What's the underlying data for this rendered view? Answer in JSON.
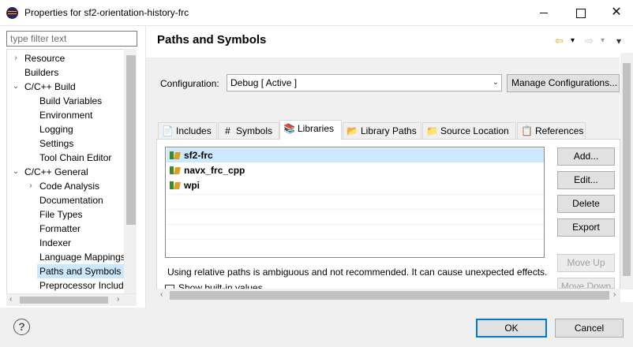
{
  "window": {
    "title": "Properties for sf2-orientation-history-frc",
    "minimize_icon": "minimize-icon",
    "maximize_icon": "maximize-icon",
    "close_glyph": "✕"
  },
  "filter": {
    "placeholder": "type filter text",
    "value": ""
  },
  "tree": {
    "items": [
      {
        "label": "Resource",
        "expander": "›"
      },
      {
        "label": "Builders",
        "expander": ""
      },
      {
        "label": "C/C++ Build",
        "expander": "⌄"
      },
      {
        "label": "Build Variables",
        "expander": ""
      },
      {
        "label": "Environment",
        "expander": ""
      },
      {
        "label": "Logging",
        "expander": ""
      },
      {
        "label": "Settings",
        "expander": ""
      },
      {
        "label": "Tool Chain Editor",
        "expander": ""
      },
      {
        "label": "C/C++ General",
        "expander": "⌄"
      },
      {
        "label": "Code Analysis",
        "expander": "›"
      },
      {
        "label": "Documentation",
        "expander": ""
      },
      {
        "label": "File Types",
        "expander": ""
      },
      {
        "label": "Formatter",
        "expander": ""
      },
      {
        "label": "Indexer",
        "expander": ""
      },
      {
        "label": "Language Mappings",
        "expander": ""
      },
      {
        "label": "Paths and Symbols",
        "expander": "",
        "selected": true
      },
      {
        "label": "Preprocessor Include Paths",
        "expander": ""
      }
    ],
    "scroll_left": "‹",
    "scroll_right": "›"
  },
  "page": {
    "title": "Paths and Symbols",
    "back_icon": "⇦",
    "forward_icon": "⇨",
    "dropdown_glyph": "▾",
    "menu_glyph": "▾"
  },
  "configuration": {
    "label": "Configuration:",
    "value": "Debug  [ Active ]",
    "dropdown_glyph": "⌄",
    "manage_button": "Manage Configurations..."
  },
  "tabs": [
    {
      "label": "Includes",
      "icon": "📄"
    },
    {
      "label": "Symbols",
      "icon": "#"
    },
    {
      "label": "Libraries",
      "icon": "📚",
      "active": true
    },
    {
      "label": "Library Paths",
      "icon": "📂"
    },
    {
      "label": "Source Location",
      "icon": "📁"
    },
    {
      "label": "References",
      "icon": "📋"
    }
  ],
  "libraries": [
    {
      "name": "sf2-frc",
      "selected": true
    },
    {
      "name": "navx_frc_cpp"
    },
    {
      "name": "wpi"
    }
  ],
  "side_buttons": {
    "add": "Add...",
    "edit": "Edit...",
    "delete": "Delete",
    "export": "Export",
    "move_up": "Move Up",
    "move_down": "Move Down"
  },
  "warning": "Using relative paths is ambiguous and not recommended. It can cause unexpected effects.",
  "show_builtin_label": "Show built-in values",
  "footer": {
    "help_glyph": "?",
    "ok": "OK",
    "cancel": "Cancel"
  },
  "colors": {
    "selection": "#cce8ff",
    "default_button_border": "#0078d7",
    "panel_background": "#f0f0f0"
  }
}
